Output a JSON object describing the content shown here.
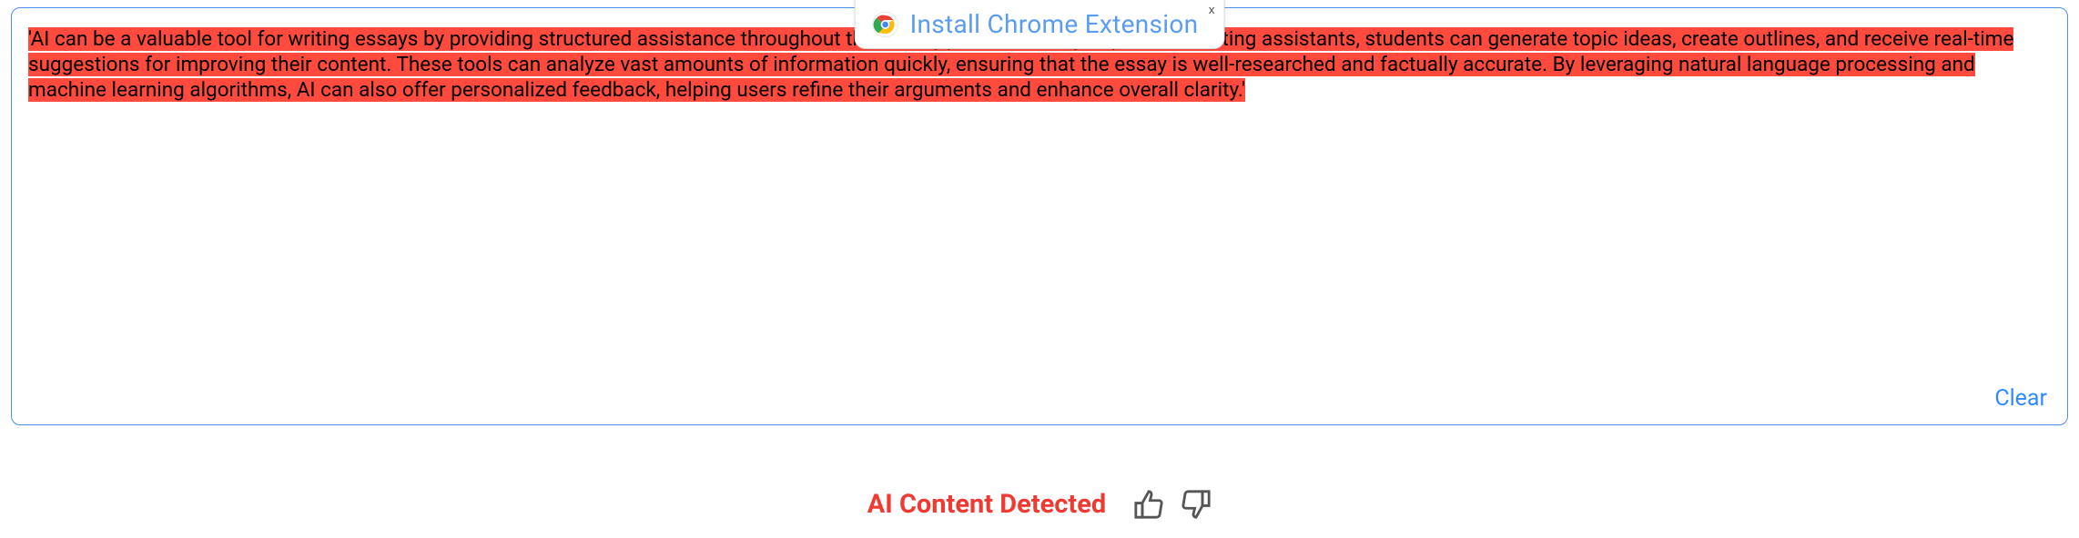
{
  "textbox": {
    "highlighted_content": "'AI can be a valuable tool for writing essays by providing structured assistance throughout the writing process. Using AI-powered writing assistants, students can generate topic ideas, create outlines, and receive real-time suggestions for improving their content. These tools can analyze vast amounts of information quickly, ensuring that the essay is well-researched and factually accurate. By leveraging natural language processing and machine learning algorithms, AI can also offer personalized feedback, helping users refine their arguments and enhance overall clarity.'",
    "clear_label": "Clear"
  },
  "banner": {
    "text": "Install Chrome Extension",
    "close_label": "x"
  },
  "status": {
    "message": "AI Content Detected"
  },
  "colors": {
    "highlight": "#ff4a3d",
    "border": "#4a8ff0",
    "link": "#2f8aff",
    "status_red": "#ee3a32",
    "banner_text": "#5a9cf2"
  }
}
